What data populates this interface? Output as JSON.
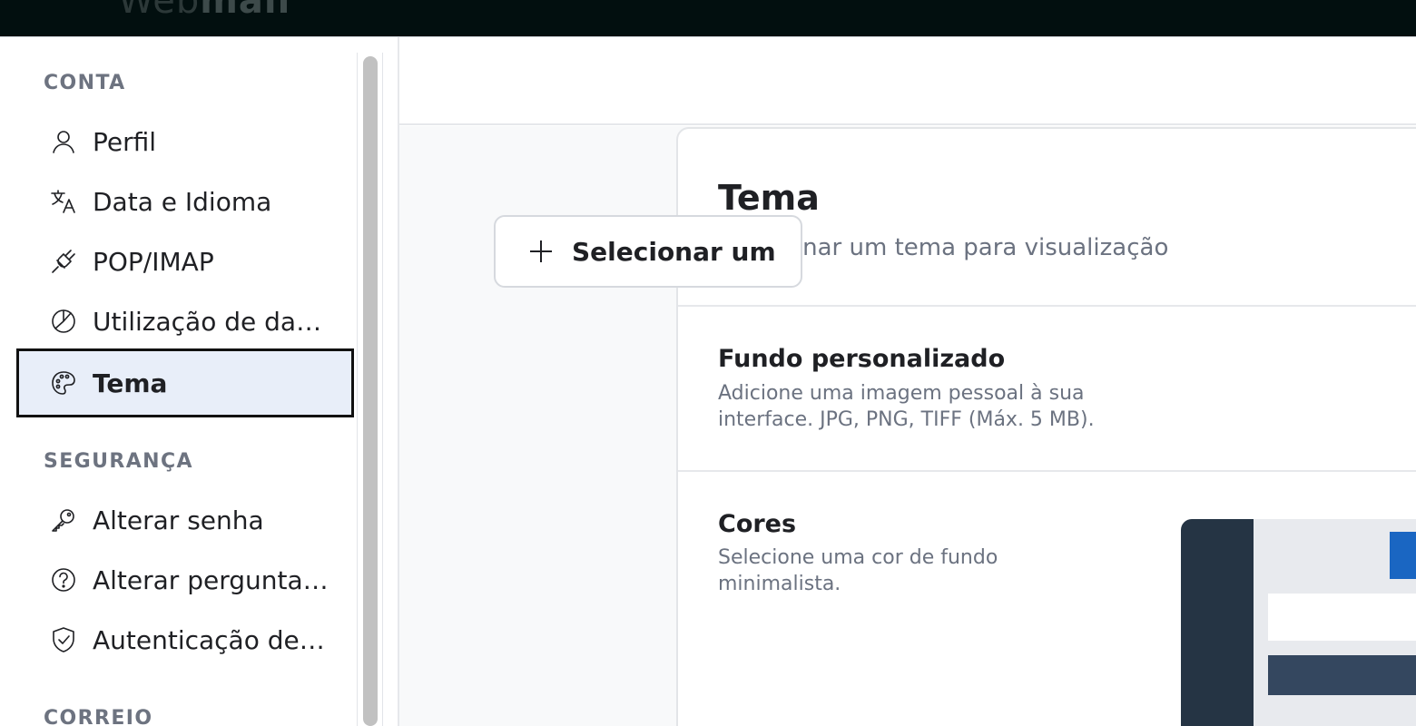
{
  "app": {
    "logo_light": "Web",
    "logo_bold": "mail"
  },
  "sidebar": {
    "sections": [
      {
        "title": "CONTA"
      },
      {
        "title": "SEGURANÇA"
      },
      {
        "title": "CORREIO"
      }
    ],
    "items": [
      {
        "label": "Perfil",
        "icon": "user-icon"
      },
      {
        "label": "Data e Idioma",
        "icon": "translate-icon"
      },
      {
        "label": "POP/IMAP",
        "icon": "plug-icon"
      },
      {
        "label": "Utilização de dad...",
        "icon": "pie-chart-icon"
      },
      {
        "label": "Tema",
        "icon": "palette-icon",
        "active": true
      },
      {
        "label": "Alterar senha",
        "icon": "key-icon"
      },
      {
        "label": "Alterar pergunta ...",
        "icon": "question-circle-icon"
      },
      {
        "label": "Autenticação de ...",
        "icon": "shield-check-icon"
      }
    ]
  },
  "card": {
    "title": "Tema",
    "subtitle": "Selecionar um tema para visualização",
    "background": {
      "title": "Fundo personalizado",
      "description": "Adicione uma imagem pessoal à sua interface. JPG, PNG, TIFF (Máx. 5 MB).",
      "button_label": "Selecionar um"
    },
    "colors": {
      "title": "Cores",
      "description": "Selecione uma cor de fundo minimalista."
    }
  },
  "theme_colors": {
    "sidebar_dark": "#253444",
    "accent": "#1a66c2",
    "active_item_bg": "#e8eef9"
  }
}
